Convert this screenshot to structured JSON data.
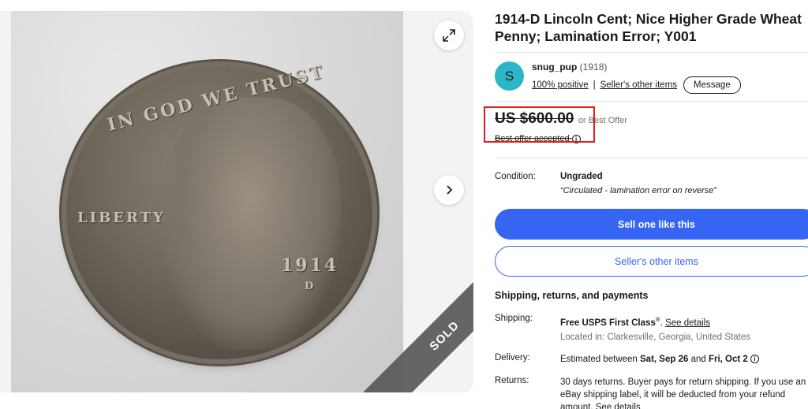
{
  "gallery": {
    "coin_motto": "IN GOD WE TRUST",
    "coin_liberty": "LIBERTY",
    "coin_year": "1914",
    "coin_mint": "D",
    "sold_label": "SOLD",
    "icons": {
      "expand": "expand-icon",
      "next": "chevron-right-icon"
    }
  },
  "listing": {
    "title": "1914-D Lincoln Cent; Nice Higher Grade Wheat Penny; Lamination Error; Y001"
  },
  "seller": {
    "initial": "S",
    "name": "snug_pup",
    "feedback_count": "(1918)",
    "positive": "100% positive",
    "other_items_link": "Seller's other items",
    "message_label": "Message"
  },
  "price": {
    "amount": "US $600.00",
    "suffix": "or Best Offer",
    "best_offer_note": "Best offer accepted"
  },
  "condition": {
    "label": "Condition:",
    "value": "Ungraded",
    "note": "“Circulated - lamination error on reverse”"
  },
  "actions": {
    "sell_one": "Sell one like this",
    "seller_other_items": "Seller's other items"
  },
  "shipping": {
    "section_title": "Shipping, returns, and payments",
    "shipping_label": "Shipping:",
    "shipping_value": "Free USPS First Class",
    "shipping_reg": "®",
    "see_details": "See details",
    "located_in": "Located in: Clarkesville, Georgia, United States",
    "delivery_label": "Delivery:",
    "delivery_prefix": "Estimated between ",
    "delivery_dates": "Sat, Sep 26",
    "delivery_and": " and ",
    "delivery_dates_end": "Fri, Oct 2",
    "returns_label": "Returns:",
    "returns_value": "30 days returns. Buyer pays for return shipping. If you use an eBay shipping label, it will be deducted from your refund amount.",
    "returns_link": "See details"
  },
  "colors": {
    "accent_blue": "#3665f3",
    "highlight_red": "#e21b1b",
    "avatar_teal": "#2cb5c4"
  }
}
